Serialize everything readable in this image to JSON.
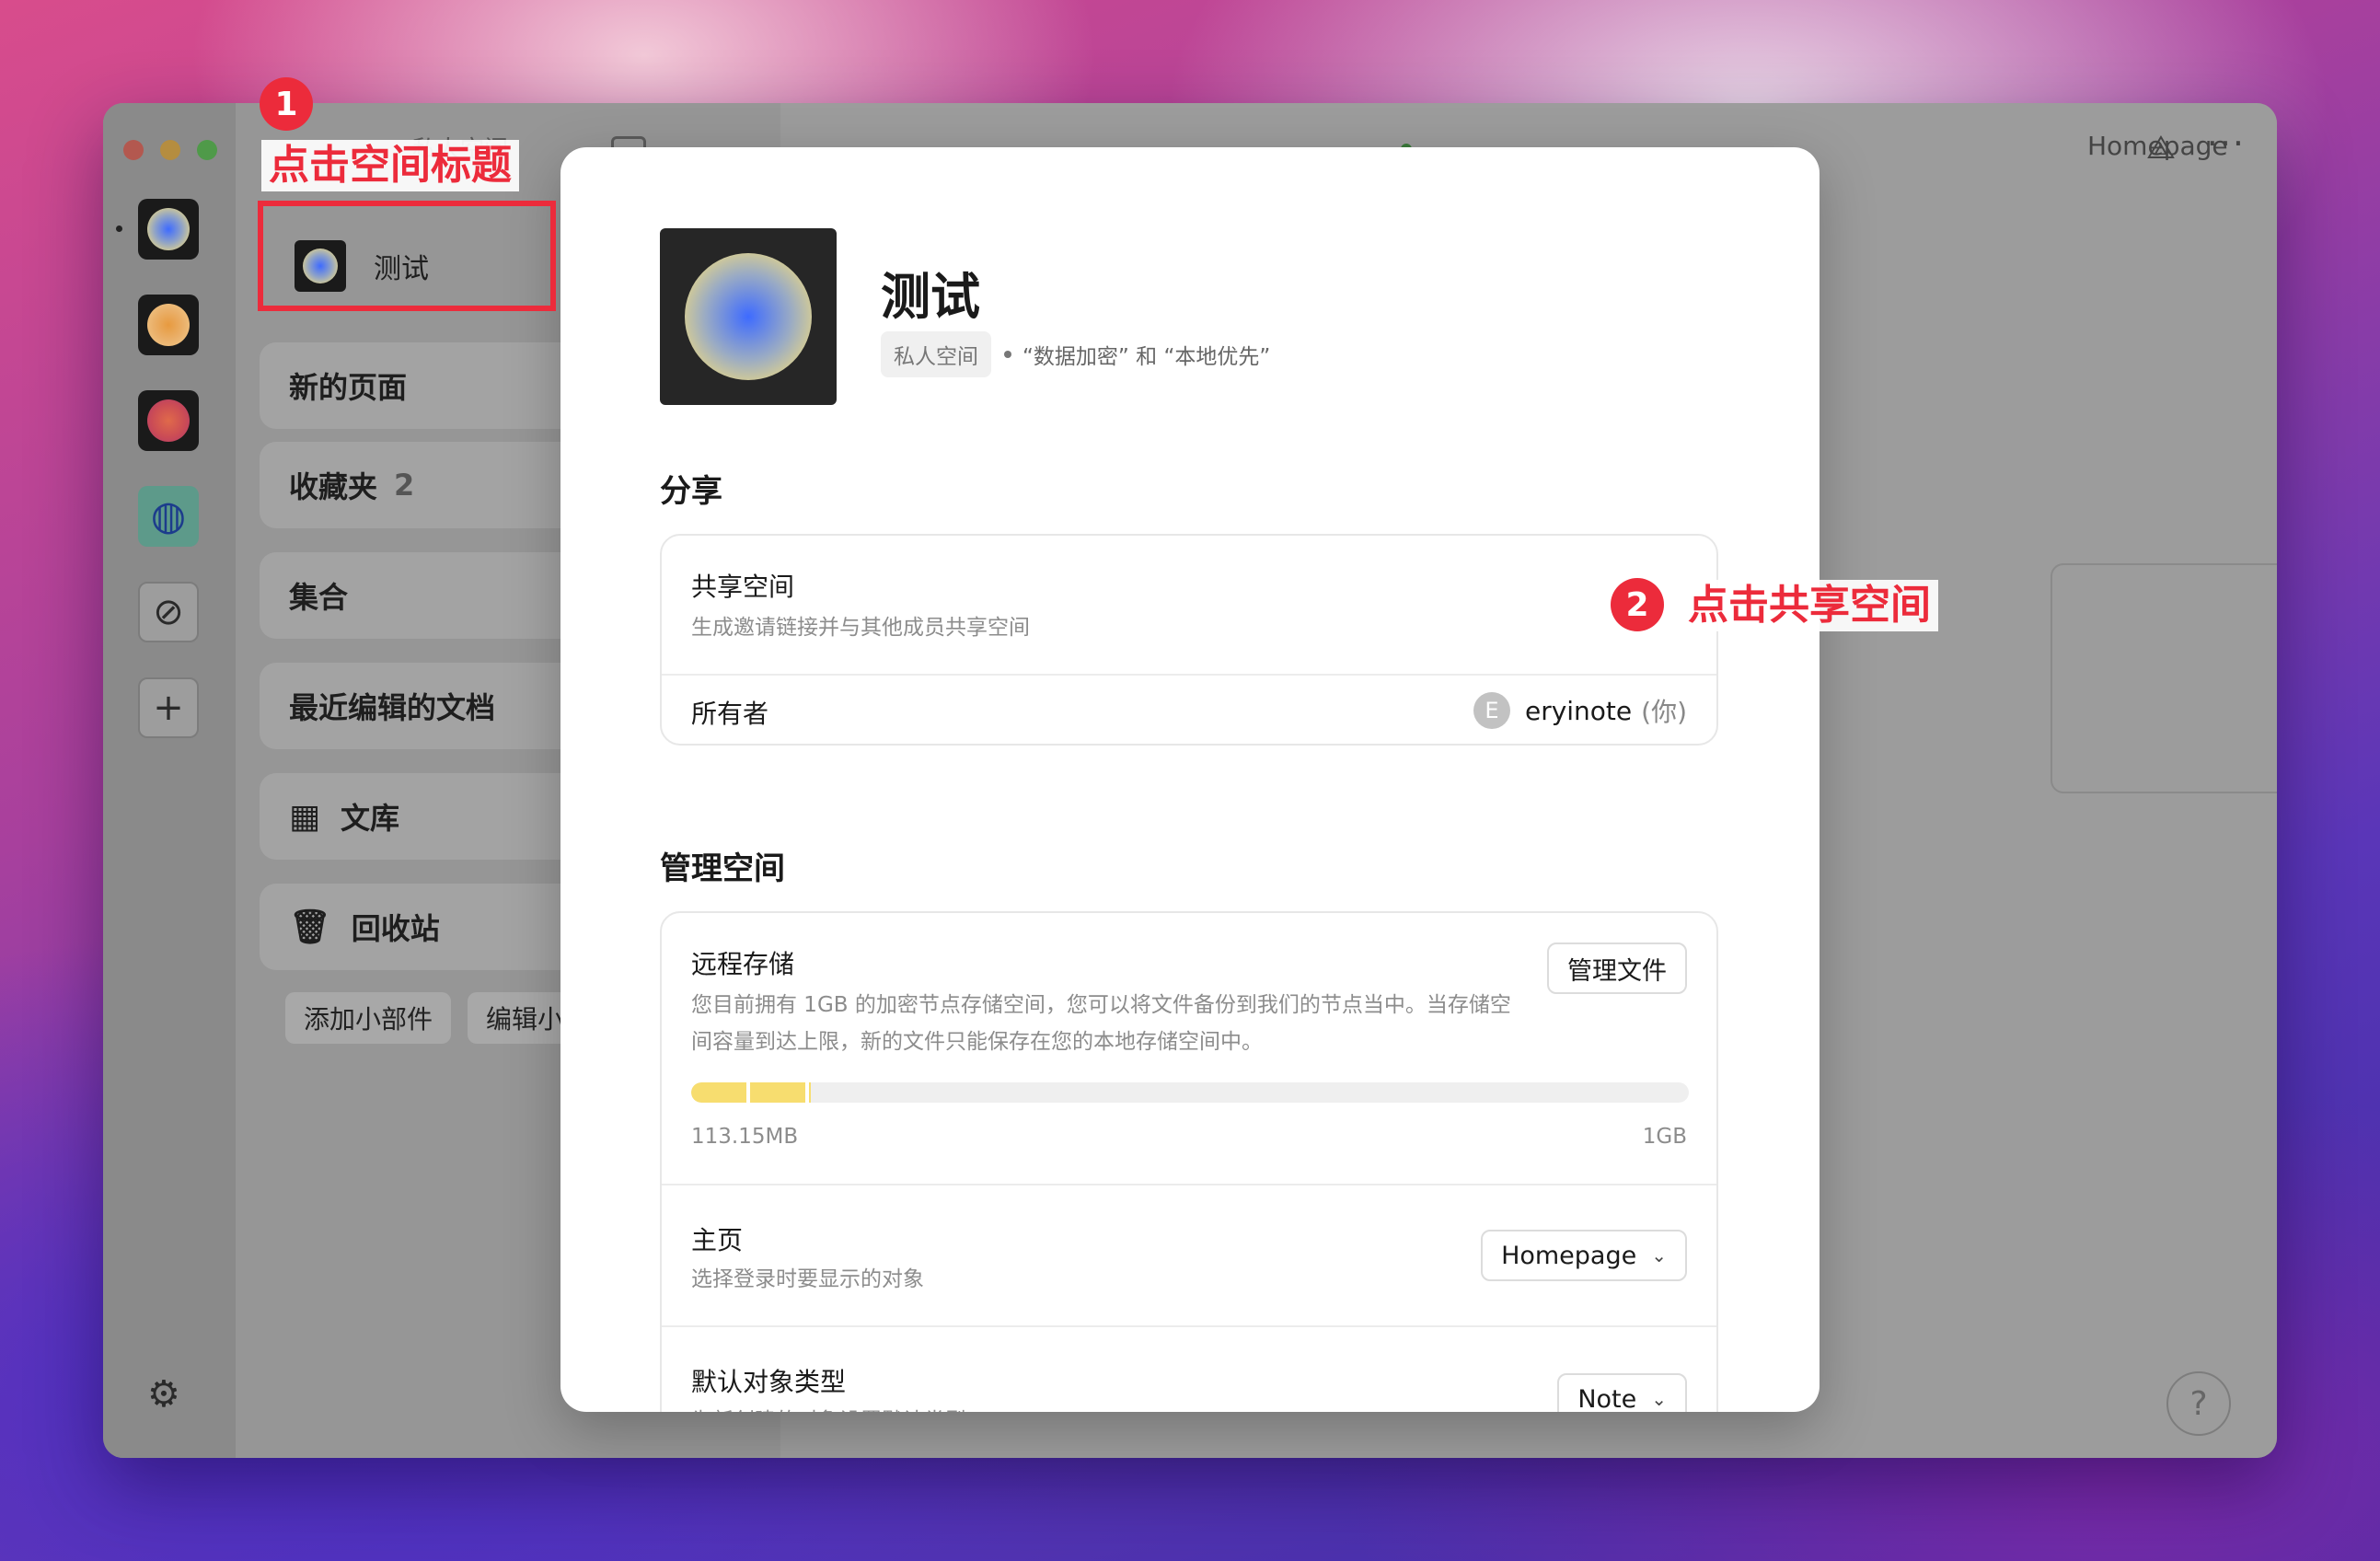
{
  "window": {
    "sidebar_title": "私人空间",
    "main_title": "Homepage"
  },
  "rail": {
    "items": [
      {
        "name": "space-test",
        "orb_inner": "#3e6bff",
        "orb_outer": "#f3dd7c"
      },
      {
        "name": "space-2",
        "orb_inner": "#e79a3f",
        "orb_outer": "#f2c98a"
      },
      {
        "name": "space-3",
        "orb_inner": "#e06a4a",
        "orb_outer": "#b33a6a"
      }
    ],
    "add_glyph": "+",
    "settings_glyph": "⚙"
  },
  "sidebar": {
    "space_name": "测试",
    "cards": [
      {
        "label": "新的页面"
      },
      {
        "label": "收藏夹",
        "count": "2"
      },
      {
        "label": "集合"
      },
      {
        "label": "最近编辑的文档"
      },
      {
        "label": "文库"
      },
      {
        "label": "回收站"
      }
    ],
    "chips": [
      "添加小部件",
      "编辑小"
    ]
  },
  "modal": {
    "space_name": "测试",
    "tag": "私人空间",
    "meta": "“数据加密” 和 “本地优先”",
    "share_section": "分享",
    "share_row": {
      "title": "共享空间",
      "subtitle": "生成邀请链接并与其他成员共享空间"
    },
    "owner_row": {
      "title": "所有者",
      "avatar_letter": "E",
      "owner_name": "eryinote",
      "you": "(你)"
    },
    "manage_section": "管理空间",
    "storage_row": {
      "title": "远程存储",
      "subtitle": "您目前拥有 1GB 的加密节点存储空间，您可以将文件备份到我们的节点当中。当存储空间容量到达上限，新的文件只能保存在您的本地存储空间中。",
      "button": "管理文件",
      "used": "113.15MB",
      "total": "1GB",
      "used_fraction": 0.12
    },
    "home_row": {
      "title": "主页",
      "subtitle": "选择登录时要显示的对象",
      "value": "Homepage"
    },
    "type_row": {
      "title": "默认对象类型",
      "subtitle": "为新创建的对象设置默认类型",
      "value": "Note"
    }
  },
  "annotations": {
    "step1": {
      "number": "1",
      "text": "点击空间标题"
    },
    "step2": {
      "number": "2",
      "text": "点击共享空间"
    },
    "color": "#ec2b3b"
  }
}
